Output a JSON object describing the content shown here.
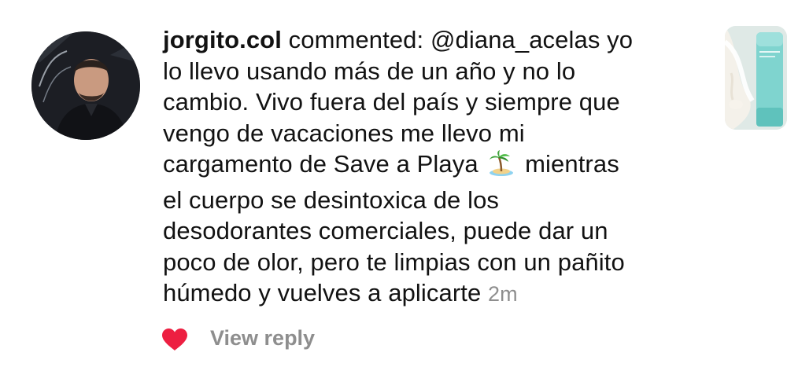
{
  "notification": {
    "username": "jorgito.col",
    "action": "commented:",
    "mention": "@diana_acelas",
    "lines": {
      "l1_rest": "yo",
      "l2": "lo llevo usando más de un año y no lo",
      "l3": "cambio. Vivo fuera del país y siempre que",
      "l4": "vengo de vacaciones me llevo mi",
      "l5a": "cargamento de Save a Playa",
      "l5b": "mientras",
      "l6": "el cuerpo se desintoxica de los",
      "l7": "desodorantes comerciales, puede dar un",
      "l8": "poco de olor, pero te limpias con un pañito",
      "l9": "húmedo y vuelves a aplicarte"
    },
    "emoji": "desert-island",
    "timestamp": "2m",
    "reply_label": "View reply",
    "liked": true
  },
  "icons": {
    "heart": "heart-icon",
    "avatar": "avatar",
    "post_thumbnail": "post-thumbnail"
  },
  "colors": {
    "text": "#121212",
    "muted": "#8e8e8e",
    "heart": "#ed1f41"
  }
}
